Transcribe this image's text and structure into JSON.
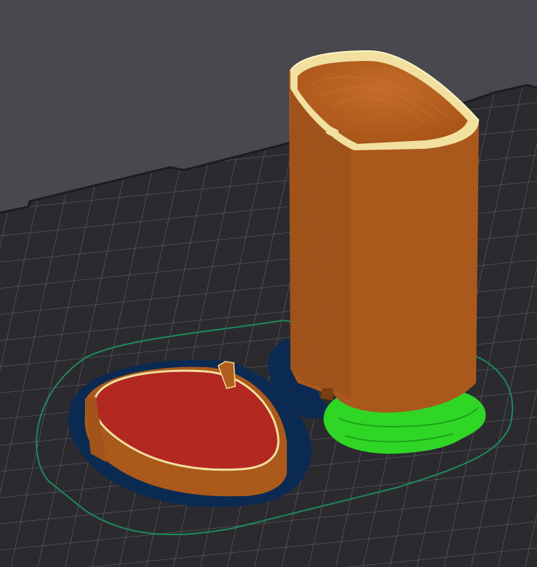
{
  "viewport": {
    "kind": "slicer-3d-preview",
    "background_color": "#48484e",
    "bed_color": "#2b2b2f",
    "bed_grid_color": "#6d6d72",
    "skirt_color": "#1f8a5c"
  },
  "objects": [
    {
      "name": "lid",
      "wall_color": "#b25e1c",
      "top_surface_color": "#b82b22",
      "brim_color": "#0b2a52",
      "perimeter_highlight_color": "#f1e0a0"
    },
    {
      "name": "container",
      "wall_color": "#b05c1e",
      "inner_wall_color": "#bd6624",
      "brim_color": "#0b2a52",
      "support_color": "#2fd625",
      "perimeter_highlight_color": "#f1e0a0"
    }
  ]
}
